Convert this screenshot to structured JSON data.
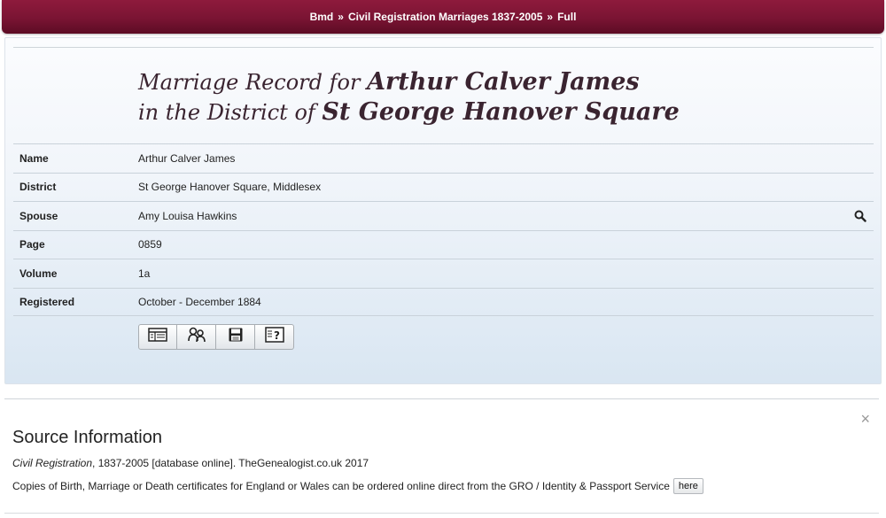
{
  "breadcrumb": {
    "items": [
      "Bmd",
      "Civil Registration Marriages 1837-2005",
      "Full"
    ],
    "separator": "»"
  },
  "heading": {
    "line1_prefix": "Marriage Record for",
    "line1_name": "Arthur Calver James",
    "line2_prefix": "in the District of",
    "line2_district": "St George Hanover Square"
  },
  "record": {
    "rows": [
      {
        "label": "Name",
        "value": "Arthur Calver James"
      },
      {
        "label": "District",
        "value": "St George Hanover Square, Middlesex"
      },
      {
        "label": "Spouse",
        "value": "Amy Louisa Hawkins"
      },
      {
        "label": "Page",
        "value": "0859"
      },
      {
        "label": "Volume",
        "value": "1a"
      },
      {
        "label": "Registered",
        "value": "October - December 1884"
      }
    ]
  },
  "toolbar": {
    "icons": [
      "transcript-icon",
      "link-people-icon",
      "save-icon",
      "help-icon"
    ]
  },
  "source": {
    "title": "Source Information",
    "cite_title": "Civil Registration",
    "cite_rest": ", 1837-2005 [database online]. TheGenealogist.co.uk 2017",
    "copies_text": "Copies of Birth, Marriage or Death certificates for England or Wales can be ordered online direct from the GRO / Identity & Passport Service",
    "here_label": "here",
    "close_label": "×"
  },
  "colors": {
    "topbar": "#7a1433",
    "heading": "#3a2430",
    "panel_gradient_bottom": "#d9e6f2"
  }
}
